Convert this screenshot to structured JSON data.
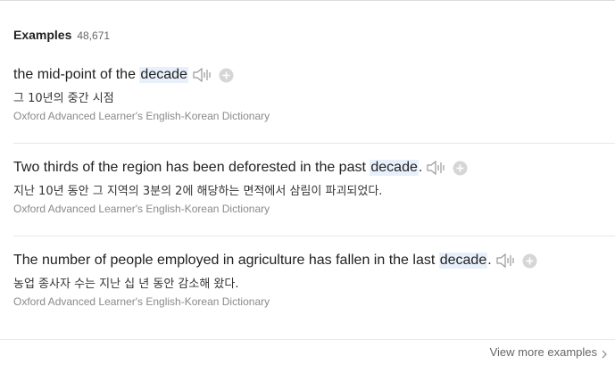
{
  "header": {
    "title": "Examples",
    "count": "48,671"
  },
  "examples": [
    {
      "before": "the mid-point of the ",
      "highlight": "decade",
      "after": "",
      "translation": "그 10년의 중간 시점",
      "source": "Oxford Advanced Learner's English-Korean Dictionary"
    },
    {
      "before": "Two thirds of the region has been deforested in the past ",
      "highlight": "decade",
      "after": ".",
      "translation": "지난 10년 동안 그 지역의 3분의 2에 해당하는 면적에서 삼림이 파괴되었다.",
      "source": "Oxford Advanced Learner's English-Korean Dictionary"
    },
    {
      "before": "The number of people employed in agriculture has fallen in the last ",
      "highlight": "decade",
      "after": ".",
      "translation": "농업 종사자 수는 지난 십 년 동안 감소해 왔다.",
      "source": "Oxford Advanced Learner's English-Korean Dictionary"
    }
  ],
  "footer": {
    "more_label": "View more examples"
  },
  "icons": {
    "audio": "speaker-icon",
    "add": "plus-circle-icon",
    "more": "chevron-right-icon"
  },
  "colors": {
    "highlight_bg": "#e8f1fb",
    "source_text": "#8a8a8a",
    "icon_gray": "#9a9a9a"
  }
}
